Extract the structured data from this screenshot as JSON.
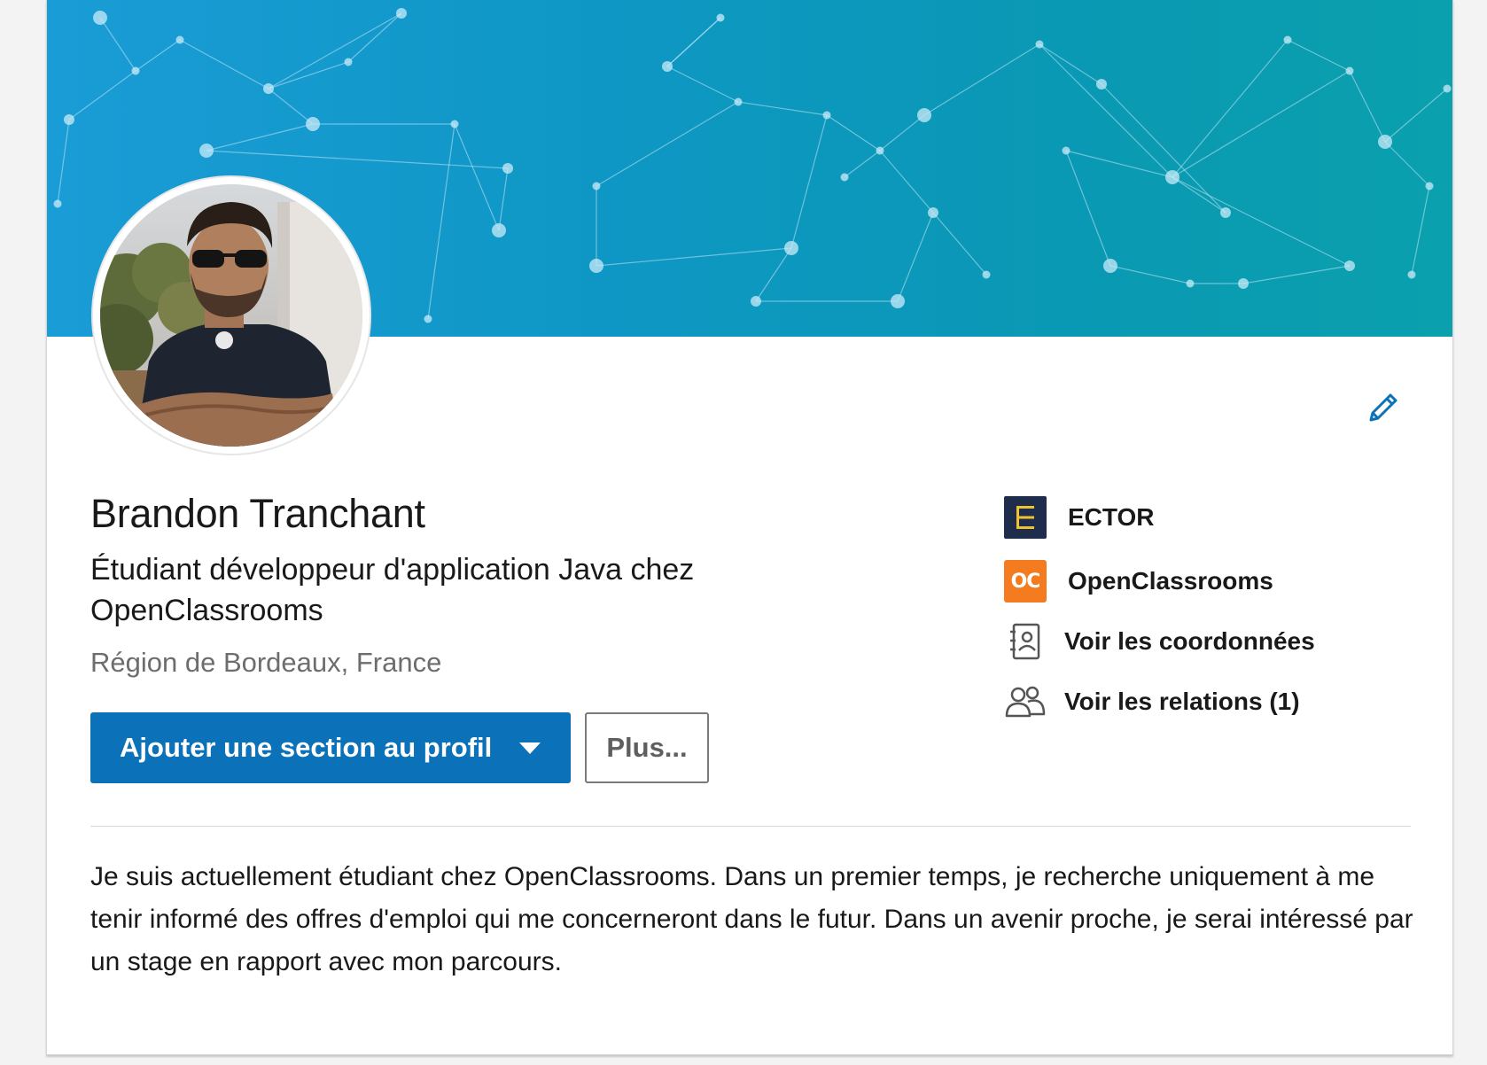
{
  "profile": {
    "name": "Brandon Tranchant",
    "headline": "Étudiant développeur d'application Java chez OpenClassrooms",
    "location": "Région de Bordeaux, France",
    "summary": "Je suis actuellement étudiant chez OpenClassrooms. Dans un premier temps, je recherche uniquement à me tenir informé des offres d'emploi qui me concerneront dans le futur. Dans un avenir proche, je serai intéressé par un stage en rapport avec mon parcours."
  },
  "actions": {
    "add_section_label": "Ajouter une section au profil",
    "more_label": "Plus..."
  },
  "sidebar": {
    "items": [
      {
        "label": "ECTOR",
        "icon": "ector-logo"
      },
      {
        "label": "OpenClassrooms",
        "icon": "openclassrooms-logo",
        "logo_text": "OC"
      },
      {
        "label": "Voir les coordonnées",
        "icon": "contact-card-icon"
      },
      {
        "label": "Voir les relations (1)",
        "icon": "people-icon"
      }
    ]
  },
  "colors": {
    "primary": "#0b72b9",
    "banner": "#0e97c4",
    "ector_bg": "#1f2d4d",
    "ector_fg": "#f2c12e",
    "oc_bg": "#f47b20"
  }
}
